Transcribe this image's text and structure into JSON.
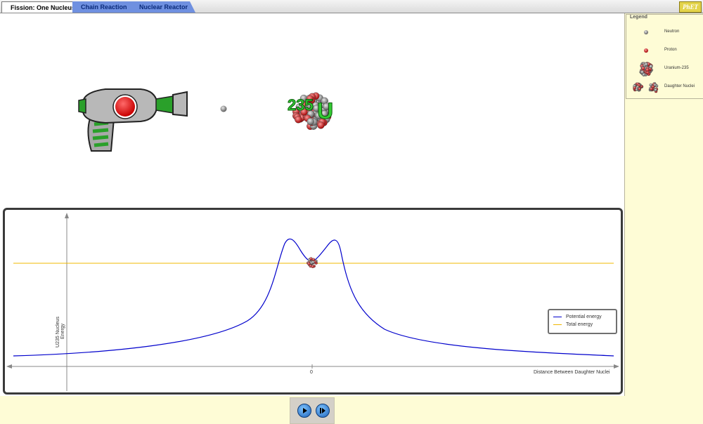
{
  "tabs": [
    {
      "label": "Fission: One Nucleus",
      "active": true
    },
    {
      "label": "Chain Reaction",
      "active": false
    },
    {
      "label": "Nuclear Reactor",
      "active": false
    }
  ],
  "logo_text": "PhET",
  "nucleus_label": {
    "mass_number": "235",
    "symbol": "U"
  },
  "graph": {
    "y_axis_label_line1": "U235 Nucleus",
    "y_axis_label_line2": "Energy",
    "x_axis_label": "Distance Between Daughter Nuclei",
    "x_tick_label": "0",
    "legend": {
      "potential_label": "Potential energy",
      "total_label": "Total energy"
    }
  },
  "legend": {
    "title": "Legend",
    "items": [
      {
        "label": "Neutron",
        "icon": "neutron-icon"
      },
      {
        "label": "Proton",
        "icon": "proton-icon"
      },
      {
        "label": "Uranium-235",
        "icon": "uranium-235-icon"
      },
      {
        "label": "Daughter Nuclei",
        "icon": "daughter-nuclei-icon"
      }
    ]
  },
  "colors": {
    "potential_energy": "#0000cc",
    "total_energy": "#f0b800",
    "tab_inactive": "#6f90e0",
    "background": "#fefcd6"
  }
}
